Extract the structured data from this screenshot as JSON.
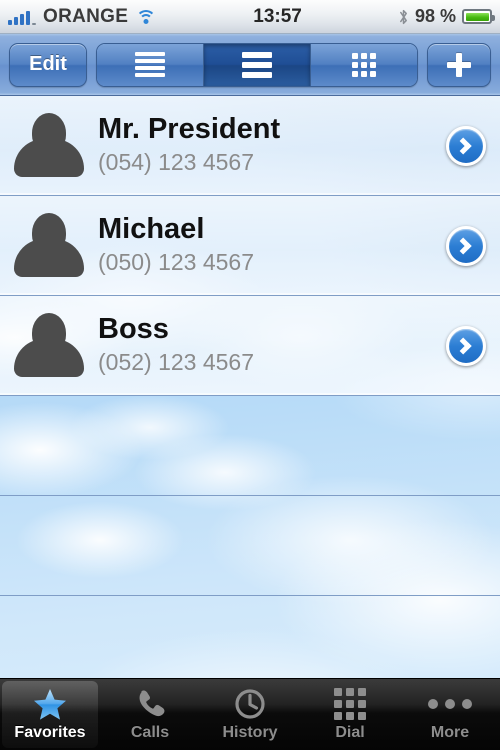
{
  "status_bar": {
    "signal_icon": "signal-bars-icon",
    "carrier": "ORANGE",
    "wifi_icon": "wifi-icon",
    "time": "13:57",
    "bluetooth_icon": "bluetooth-icon",
    "battery_percent": "98 %",
    "battery_icon": "battery-icon",
    "battery_color": "#46b910",
    "signal_color": "#2f72c4"
  },
  "toolbar": {
    "edit_label": "Edit",
    "add_label": "+",
    "accent_color": "#3d6fb6",
    "segments": [
      {
        "name": "list-thin-view",
        "icon": "list-lines-icon",
        "selected": false
      },
      {
        "name": "list-thick-view",
        "icon": "list-thick-lines-icon",
        "selected": true
      },
      {
        "name": "grid-view",
        "icon": "grid-dots-icon",
        "selected": false
      }
    ]
  },
  "contacts": [
    {
      "name": "Mr. President",
      "phone": "(054) 123 4567",
      "avatar": "person-silhouette-icon"
    },
    {
      "name": "Michael",
      "phone": "(050) 123 4567",
      "avatar": "person-silhouette-icon"
    },
    {
      "name": "Boss",
      "phone": "(052) 123 4567",
      "avatar": "person-silhouette-icon"
    }
  ],
  "empty_rows": 3,
  "tabs": [
    {
      "label": "Favorites",
      "icon": "star-icon",
      "selected": true
    },
    {
      "label": "Calls",
      "icon": "phone-handset-icon",
      "selected": false
    },
    {
      "label": "History",
      "icon": "clock-icon",
      "selected": false
    },
    {
      "label": "Dial",
      "icon": "keypad-icon",
      "selected": false
    },
    {
      "label": "More",
      "icon": "ellipsis-icon",
      "selected": false
    }
  ]
}
